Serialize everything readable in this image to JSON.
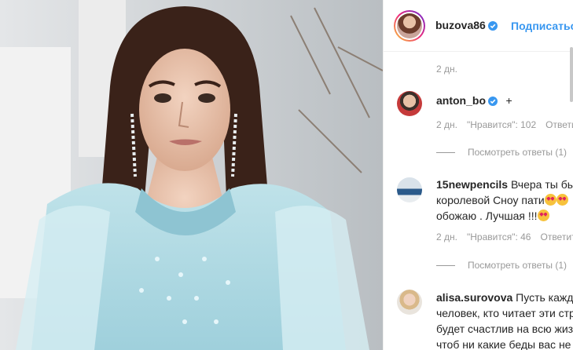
{
  "post": {
    "image_alt": "photo of a woman in a light-blue feathered dress"
  },
  "header": {
    "username": "buzova86",
    "follow_label": "Подписаться"
  },
  "caption": {
    "time": "2 дн."
  },
  "comments": [
    {
      "username": "anton_bo",
      "text": "+",
      "time": "2 дн.",
      "likes": "\"Нравится\": 102",
      "reply": "Ответить",
      "view_replies": "Посмотреть ответы (1)"
    },
    {
      "username": "15newpencils",
      "text_lines": [
        "Вчера ты был",
        "королевой Сноу пати",
        "обожаю . Лучшая !!!"
      ],
      "time": "2 дн.",
      "likes": "\"Нравится\": 46",
      "reply": "Ответить",
      "view_replies": "Посмотреть ответы (1)"
    },
    {
      "username": "alisa.surovova",
      "text_lines": [
        "Пусть кажды",
        "человек, кто читает эти стр",
        "будет счастлив на всю жиз",
        "чтоб ни какие беды вас не"
      ]
    }
  ],
  "colors": {
    "link": "#3897f0",
    "verified": "#3897f0",
    "muted": "#999999",
    "text": "#262626"
  }
}
